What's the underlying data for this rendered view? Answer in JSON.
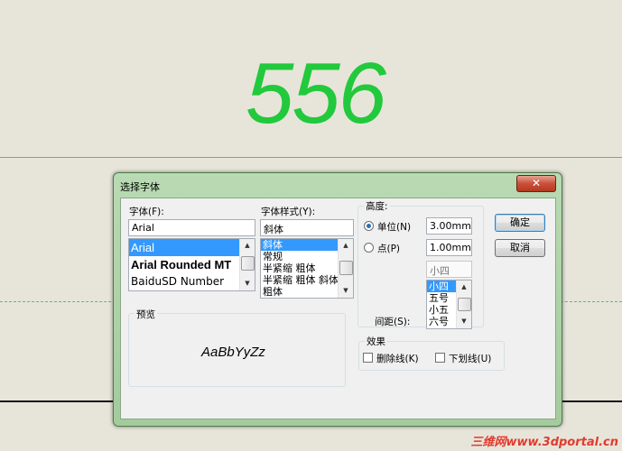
{
  "canvas": {
    "number": "556",
    "watermark": "三维网www.3dportal.cn"
  },
  "colors": {
    "number_green": "#22c93c",
    "selection_blue": "#3399ff",
    "close_red": "#c9503a"
  },
  "dialog": {
    "title": "选择字体",
    "close_icon": "close-icon",
    "font": {
      "label": "字体(F):",
      "value": "Arial",
      "items": [
        "Arial",
        "Arial Rounded MT",
        "BaiduSD Number"
      ],
      "selected": "Arial"
    },
    "style": {
      "label": "字体样式(Y):",
      "value": "斜体",
      "items": [
        "斜体",
        "常规",
        "半紧缩 粗体",
        "半紧缩 粗体 斜体",
        "粗体"
      ],
      "selected": "斜体"
    },
    "height": {
      "label": "高度:",
      "unit_option": "单位(N)",
      "unit_value": "3.00mm",
      "point_option": "点(P)",
      "point_value": "1.00mm",
      "selected_option": "单位(N)",
      "size_value": "小四",
      "size_items": [
        "小四",
        "五号",
        "小五",
        "六号"
      ],
      "spacing_label": "间距(S):"
    },
    "buttons": {
      "ok": "确定",
      "cancel": "取消"
    },
    "preview": {
      "label": "预览",
      "sample": "AaBbYyZz"
    },
    "effects": {
      "label": "效果",
      "strikeout": "删除线(K)",
      "underline": "下划线(U)",
      "strikeout_checked": false,
      "underline_checked": false
    }
  }
}
